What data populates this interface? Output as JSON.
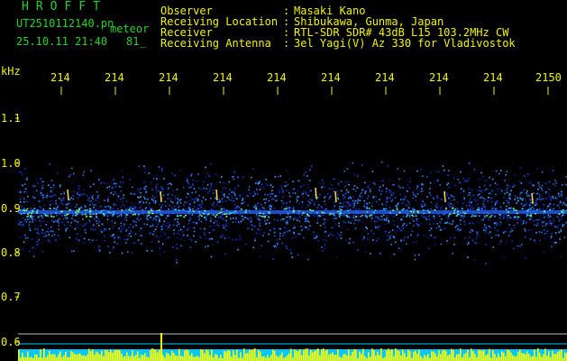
{
  "header": {
    "logo": "HROFFT",
    "filename": "UT2510112140.pn",
    "mode": "meteor",
    "datetime": "25.10.11 21:40",
    "counter": "81_",
    "info": [
      {
        "label": "Observer",
        "value": "Masaki Kano"
      },
      {
        "label": "Receiving Location",
        "value": "Shibukawa, Gunma, Japan"
      },
      {
        "label": "Receiver",
        "value": "RTL-SDR SDR# 43dB L15 103.2MHz CW"
      },
      {
        "label": "Receiving Antenna",
        "value": "3el Yagi(V) Az 330 for Vladivostok"
      }
    ]
  },
  "axes": {
    "y_unit": "kHz",
    "y_ticks": [
      "1.1",
      "1.0",
      "0.9",
      "0.8",
      "0.7",
      "0.6"
    ],
    "top_ticks": [
      "214",
      "214",
      "214",
      "214",
      "214",
      "214",
      "214",
      "214",
      "214",
      "2150"
    ]
  },
  "colors": {
    "text_green": "#21d421",
    "text_yellow": "#f2f200",
    "signal_cyan": "#00c8ff",
    "meter_yellow": "#ffff00"
  }
}
